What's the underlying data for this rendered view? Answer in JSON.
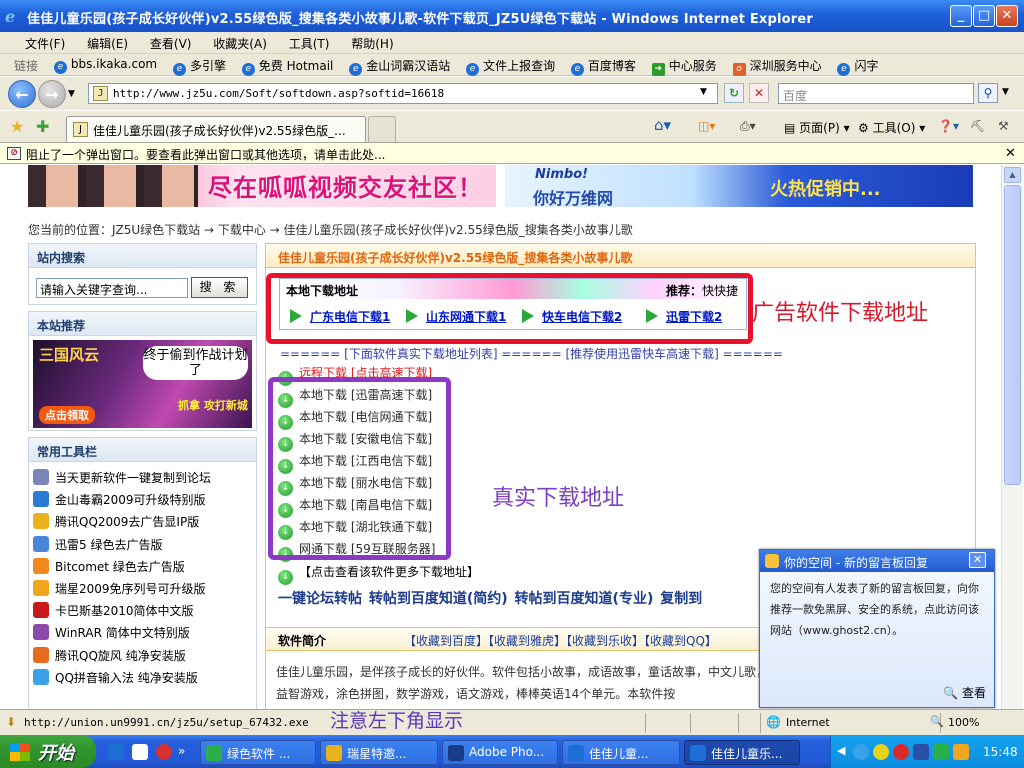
{
  "window": {
    "title": "佳佳儿童乐园(孩子成长好伙伴)v2.55绿色版_搜集各类小故事儿歌-软件下载页_JZ5U绿色下载站 - Windows Internet Explorer",
    "icon": "ie-icon"
  },
  "menu": [
    "文件(F)",
    "编辑(E)",
    "查看(V)",
    "收藏夹(A)",
    "工具(T)",
    "帮助(H)"
  ],
  "links": {
    "label": "链接",
    "items": [
      "bbs.ikaka.com",
      "多引擎",
      "免费 Hotmail",
      "金山词霸汉语站",
      "文件上报查询",
      "百度博客",
      "中心服务",
      "深圳服务中心",
      "闪字"
    ]
  },
  "address": {
    "url": "http://www.jz5u.com/Soft/softdown.asp?softid=16618",
    "search_placeholder": "百度"
  },
  "tabs": {
    "active_title": "佳佳儿童乐园(孩子成长好伙伴)v2.55绿色版_...",
    "commands": [
      "页面(P)",
      "工具(O)"
    ]
  },
  "popup_blocker": "阻止了一个弹出窗口。要查看此弹出窗口或其他选项，请单击此处...",
  "banners": {
    "left_text": "尽在呱呱视频交友社区！",
    "right_logo": "Nimbo!",
    "right_slogan": "你好万维网",
    "right_promo": "火热促销中..."
  },
  "breadcrumb": "您当前的位置：JZ5U绿色下载站 → 下载中心 → 佳佳儿童乐园(孩子成长好伙伴)v2.55绿色版_搜集各类小故事儿歌",
  "sidebar": {
    "search_title": "站内搜索",
    "search_value": "请输入关键字查询...",
    "search_button": "搜 索",
    "recommend_title": "本站推荐",
    "recommend_ad": {
      "brand": "三国风云",
      "bubble": "终于偷到作战计划了",
      "badge": "点击领取",
      "tag": "抓拿 攻打新城"
    },
    "tools_title": "常用工具栏",
    "tools": [
      {
        "label": "当天更新软件一键复制到论坛",
        "color": "#7a86b8"
      },
      {
        "label": "金山毒霸2009可升级特别版",
        "color": "#2a7ad8"
      },
      {
        "label": "腾讯QQ2009去广告显IP版",
        "color": "#e8b21c"
      },
      {
        "label": "迅雷5 绿色去广告版",
        "color": "#4a86d8"
      },
      {
        "label": "Bitcomet 绿色去广告版",
        "color": "#f08a1e"
      },
      {
        "label": "瑞星2009免序列号可升级版",
        "color": "#f0a51e"
      },
      {
        "label": "卡巴斯基2010简体中文版",
        "color": "#c81a1a"
      },
      {
        "label": "WinRAR 简体中文特别版",
        "color": "#8b4aa8"
      },
      {
        "label": "腾讯QQ旋风 纯净安装版",
        "color": "#e86a1e"
      },
      {
        "label": "QQ拼音输入法 纯净安装版",
        "color": "#3aa0e8"
      }
    ]
  },
  "main": {
    "title": "佳佳儿童乐园(孩子成长好伙伴)v2.55绿色版_搜集各类小故事儿歌",
    "ad_box": {
      "title": "本地下载地址",
      "recommend_label": "推荐：",
      "recommend_value": "快快捷",
      "links": [
        "广东电信下载1",
        "山东网通下载1",
        "快车电信下载2",
        "迅雷下载2"
      ]
    },
    "ad_annotation": "广告软件下载地址",
    "separator": "====== [下面软件真实下载地址列表] ====== [推荐使用迅雷快车高速下载] ======",
    "remote_link": "远程下载 [点击高速下载]",
    "real_links": [
      "本地下载 [迅雷高速下载]",
      "本地下载 [电信网通下载]",
      "本地下载 [安徽电信下载]",
      "本地下载 [江西电信下载]",
      "本地下载 [丽水电信下载]",
      "本地下载 [南昌电信下载]",
      "本地下载 [湖北铁通下载]",
      "网通下载 [59互联服务器]"
    ],
    "real_annotation": "真实下载地址",
    "more_link": "【点击查看该软件更多下载地址】",
    "share": "一键论坛转帖   转帖到百度知道(简约)   转帖到百度知道(专业)   复制到",
    "intro_title": "软件简介",
    "favorites": "【收藏到百度】【收藏到雅虎】【收藏到乐收】【收藏到QQ】",
    "intro_text": "佳佳儿童乐园，是伴孩子成长的好伙伴。软件包括小故事，成语故事，童话故事，中文儿歌，英文儿歌，绕口令，音，百科常识，益智游戏，涂色拼图，数学游戏，语文游戏，棒棒英语14个单元。本软件按"
  },
  "notification": {
    "title": "你的空间 - 新的留言板回复",
    "body": "您的空间有人发表了新的留言板回复，向你推荐一款免黑屏、安全的系统，点此访问该网站（www.ghost2.cn）。",
    "view": "查看"
  },
  "status": {
    "url": "http://union.un9991.cn/jz5u/setup_67432.exe",
    "annotation": "注意左下角显示",
    "zone": "Internet",
    "zoom": "100%"
  },
  "taskbar": {
    "start": "开始",
    "buttons": [
      "绿色软件 ...",
      "瑞星特邀...",
      "Adobe Pho...",
      "佳佳儿童...",
      "佳佳儿童乐..."
    ],
    "clock": "15:48"
  }
}
